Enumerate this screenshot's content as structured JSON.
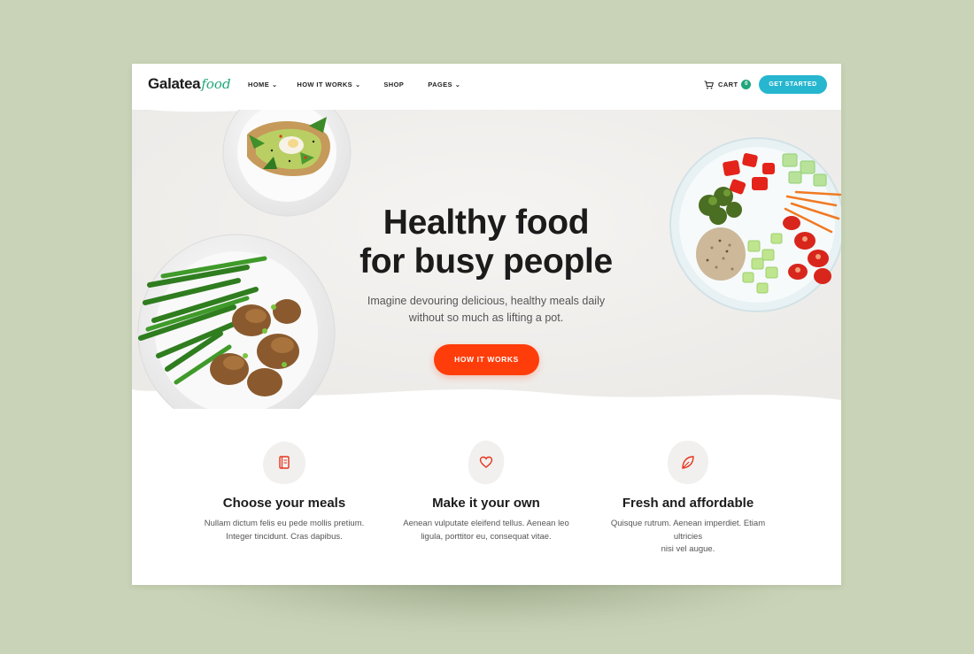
{
  "brand": {
    "name_main": "Galatea",
    "name_script": "food",
    "accent": "#1fa67a"
  },
  "nav": {
    "items": [
      {
        "label": "HOME",
        "has_dropdown": true
      },
      {
        "label": "HOW IT WORKS",
        "has_dropdown": true
      },
      {
        "label": "SHOP",
        "has_dropdown": false
      },
      {
        "label": "PAGES",
        "has_dropdown": true
      }
    ],
    "cart_label": "CART",
    "cart_count": "0",
    "cta_label": "GET STARTED",
    "cta_color": "#27b6cf"
  },
  "hero": {
    "title_line1": "Healthy food",
    "title_line2": "for busy people",
    "subtitle_line1": "Imagine devouring delicious, healthy meals daily",
    "subtitle_line2": "without so much as lifting a pot.",
    "button_label": "HOW IT WORKS",
    "button_color": "#ff3d0b"
  },
  "features": [
    {
      "icon": "menu-book-icon",
      "title": "Choose your meals",
      "text_line1": "Nullam dictum felis eu pede mollis pretium.",
      "text_line2": "Integer tincidunt. Cras dapibus."
    },
    {
      "icon": "heart-icon",
      "title": "Make it your own",
      "text_line1": "Aenean vulputate eleifend tellus. Aenean leo",
      "text_line2": "ligula, porttitor eu, consequat vitae."
    },
    {
      "icon": "leaf-icon",
      "title": "Fresh and affordable",
      "text_line1": "Quisque rutrum. Aenean imperdiet. Etiam ultricies",
      "text_line2": "nisi vel augue."
    }
  ]
}
